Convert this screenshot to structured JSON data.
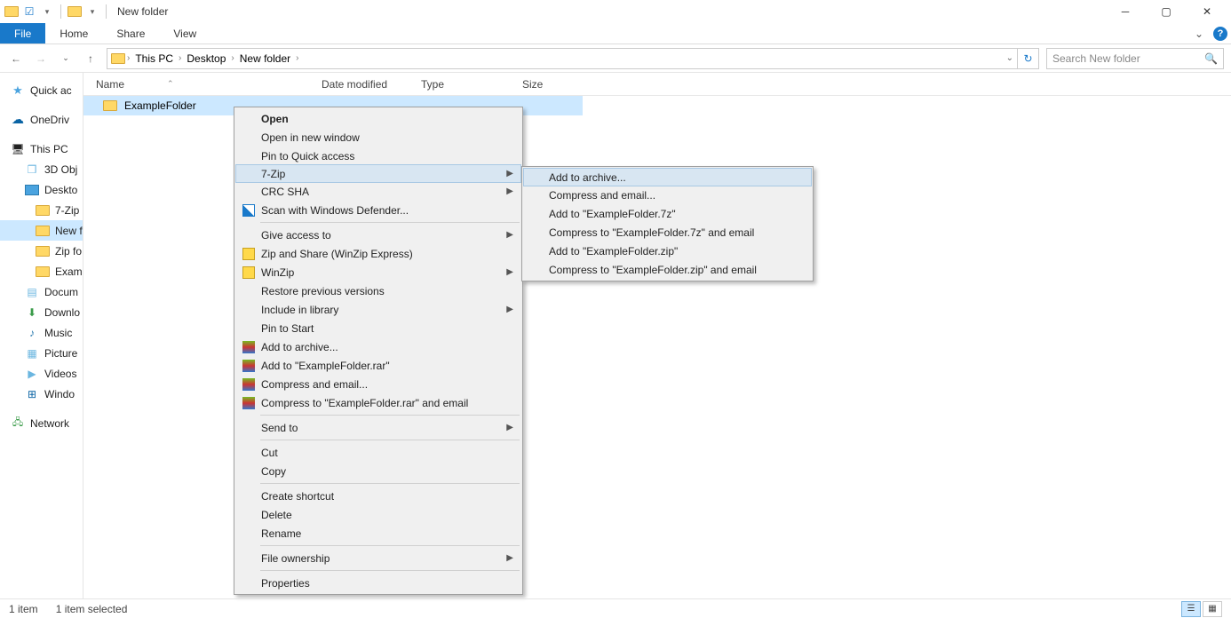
{
  "titlebar": {
    "title": "New folder"
  },
  "ribbon": {
    "file": "File",
    "home": "Home",
    "share": "Share",
    "view": "View"
  },
  "breadcrumb": {
    "pc": "This PC",
    "desktop": "Desktop",
    "folder": "New folder"
  },
  "search": {
    "placeholder": "Search New folder"
  },
  "columns": {
    "name": "Name",
    "date": "Date modified",
    "type": "Type",
    "size": "Size"
  },
  "row": {
    "name": "ExampleFolder",
    "date": "",
    "type": "",
    "size": ""
  },
  "sidebar": {
    "quick": "Quick ac",
    "onedrive": "OneDriv",
    "thispc": "This PC",
    "obj3d": "3D Obj",
    "desktop": "Deskto",
    "sevenzip": "7-Zip",
    "newf": "New f",
    "zipfo": "Zip fo",
    "examp": "Examp",
    "docs": "Docum",
    "down": "Downlo",
    "music": "Music",
    "pic": "Picture",
    "videos": "Videos",
    "windo": "Windo",
    "network": "Network"
  },
  "ctx": {
    "open": "Open",
    "open_new": "Open in new window",
    "pin_quick": "Pin to Quick access",
    "sevenzip": "7-Zip",
    "crcsha": "CRC SHA",
    "defender": "Scan with Windows Defender...",
    "give_access": "Give access to",
    "winzip_express": "Zip and Share (WinZip Express)",
    "winzip": "WinZip",
    "restore": "Restore previous versions",
    "include_lib": "Include in library",
    "pin_start": "Pin to Start",
    "add_archive": "Add to archive...",
    "add_rar": "Add to \"ExampleFolder.rar\"",
    "compress_email": "Compress and email...",
    "compress_rar_email": "Compress to \"ExampleFolder.rar\" and email",
    "send_to": "Send to",
    "cut": "Cut",
    "copy": "Copy",
    "shortcut": "Create shortcut",
    "delete": "Delete",
    "rename": "Rename",
    "file_own": "File ownership",
    "properties": "Properties"
  },
  "sub": {
    "add_archive": "Add to archive...",
    "compress_email": "Compress and email...",
    "add_7z": "Add to \"ExampleFolder.7z\"",
    "compress_7z_email": "Compress to \"ExampleFolder.7z\" and email",
    "add_zip": "Add to \"ExampleFolder.zip\"",
    "compress_zip_email": "Compress to \"ExampleFolder.zip\" and email"
  },
  "status": {
    "count": "1 item",
    "selected": "1 item selected"
  }
}
